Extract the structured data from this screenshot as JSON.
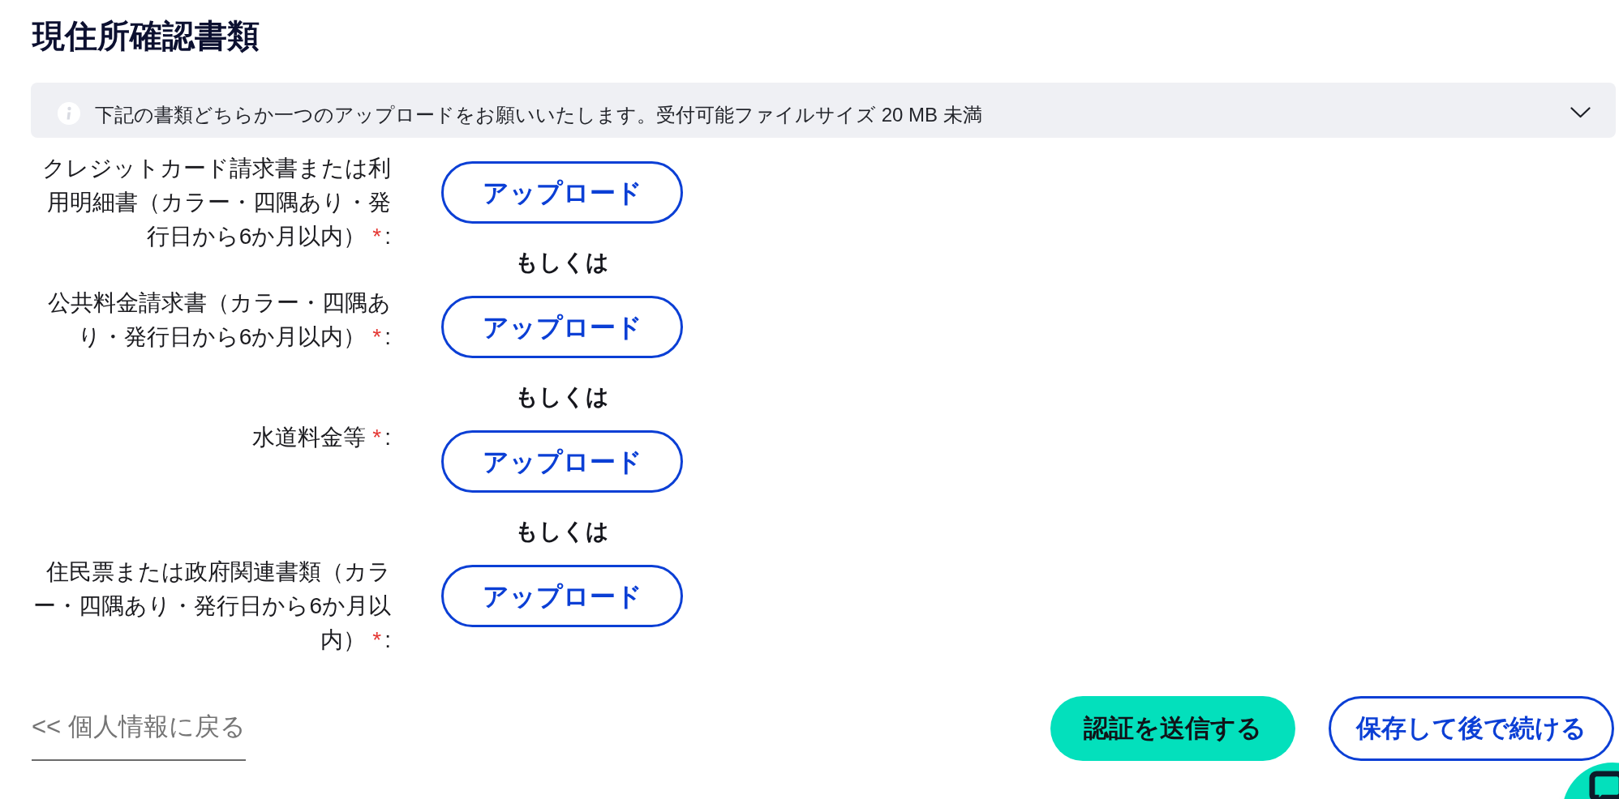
{
  "page_title": "現住所確認書類",
  "notice": {
    "text": "下記の書類どちらか一つのアップロードをお願いいたします。受付可能ファイルサイズ 20 MB 未満",
    "expanded": false
  },
  "documents": [
    {
      "label": "クレジットカード請求書または利用明細書（カラー・四隅あり・発行日から6か月以内）",
      "required_mark": "*",
      "suffix": ":",
      "button": "アップロード",
      "separator": "もしくは"
    },
    {
      "label": "公共料金請求書（カラー・四隅あり・発行日から6か月以内）",
      "required_mark": "*",
      "suffix": ":",
      "button": "アップロード",
      "separator": "もしくは"
    },
    {
      "label": "水道料金等",
      "required_mark": "*",
      "suffix": ":",
      "button": "アップロード",
      "separator": "もしくは"
    },
    {
      "label": "住民票または政府関連書類（カラー・四隅あり・発行日から6か月以内）",
      "required_mark": "*",
      "suffix": ":",
      "button": "アップロード"
    }
  ],
  "footer": {
    "back_link": "<< 個人情報に戻る",
    "buttons": [
      {
        "label": "認証を送信する",
        "kind": "primary"
      },
      {
        "label": "保存して後で続ける",
        "kind": "outline"
      }
    ]
  }
}
